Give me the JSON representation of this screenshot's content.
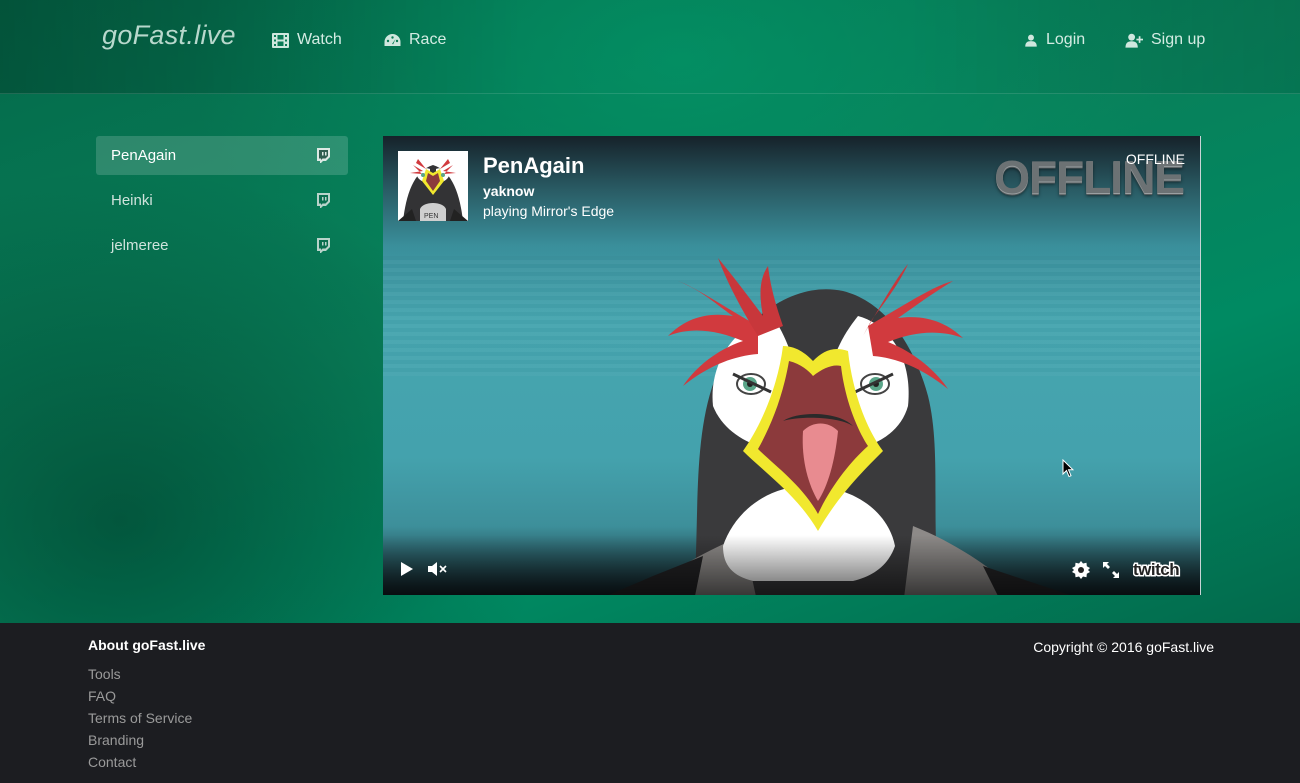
{
  "brand": {
    "prefix": "go",
    "main": "Fast",
    "suffix": ".live"
  },
  "nav": {
    "watch": "Watch",
    "race": "Race",
    "login": "Login",
    "signup": "Sign up"
  },
  "sidebar": {
    "items": [
      {
        "label": "PenAgain",
        "icon": "twitch-icon",
        "active": true
      },
      {
        "label": "Heinki",
        "icon": "twitch-icon",
        "active": false
      },
      {
        "label": "jelmeree",
        "icon": "twitch-icon",
        "active": false
      }
    ]
  },
  "player": {
    "channel_name": "PenAgain",
    "stream_title": "yaknow",
    "game_line": "playing Mirror's Edge",
    "offline_banner": "OFFLINE",
    "status": "OFFLINE",
    "controls": [
      "play-icon",
      "mute-icon",
      "gear-icon",
      "fullscreen-icon",
      "twitch-logo"
    ],
    "logo_text": "twitch"
  },
  "footer": {
    "about_heading": "About goFast.live",
    "links": [
      "Tools",
      "FAQ",
      "Terms of Service",
      "Branding",
      "Contact"
    ],
    "copyright": "Copyright © 2016 goFast.live"
  },
  "colors": {
    "accent_green": "#008a62",
    "dark_green": "#046a4a",
    "footer_bg": "#1c1d21",
    "player_teal": "#46a5af"
  }
}
